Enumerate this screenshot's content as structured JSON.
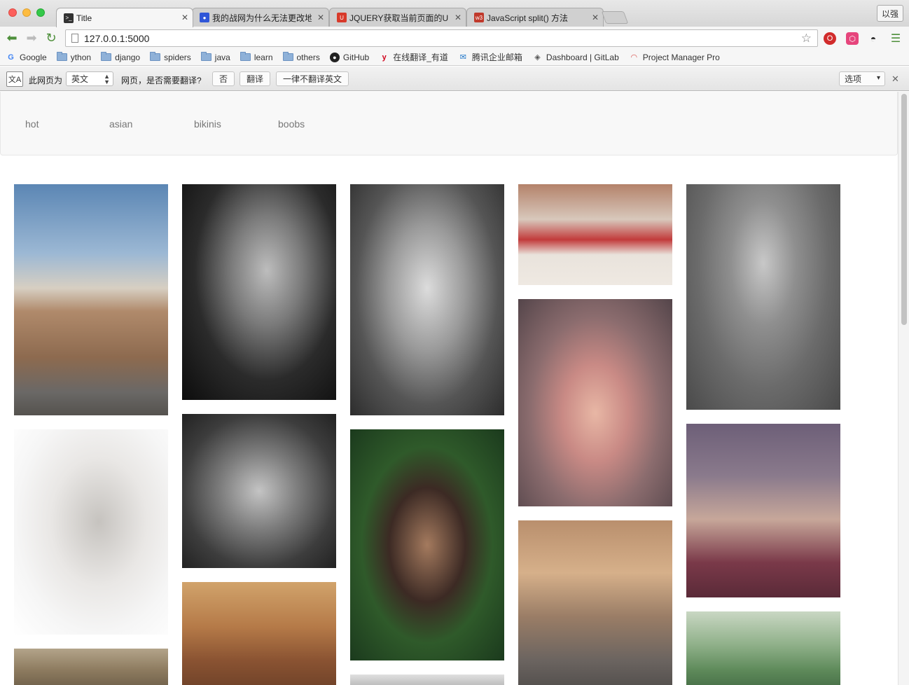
{
  "window": {
    "profile_button": "以强"
  },
  "tabs": [
    {
      "title": "Title",
      "favicon": "terminal-icon",
      "fav_color": "#333333",
      "active": true
    },
    {
      "title": "我的战网为什么无法更改地区",
      "favicon": "baidu-paw-icon",
      "fav_color": "#2f56d8",
      "active": false
    },
    {
      "title": "JQUERY获取当前页面的URL",
      "favicon": "u-logo-icon",
      "fav_color": "#d83a2a",
      "active": false
    },
    {
      "title": "JavaScript split() 方法",
      "favicon": "w3-icon",
      "fav_color": "#c0392b",
      "active": false
    }
  ],
  "toolbar": {
    "url": "127.0.0.1:5000"
  },
  "bookmarks": [
    {
      "label": "Google",
      "icon": "google-icon",
      "type": "site"
    },
    {
      "label": "ython",
      "icon": "folder-icon",
      "type": "folder"
    },
    {
      "label": "django",
      "icon": "folder-icon",
      "type": "folder"
    },
    {
      "label": "spiders",
      "icon": "folder-icon",
      "type": "folder"
    },
    {
      "label": "java",
      "icon": "folder-icon",
      "type": "folder"
    },
    {
      "label": "learn",
      "icon": "folder-icon",
      "type": "folder"
    },
    {
      "label": "others",
      "icon": "folder-icon",
      "type": "folder"
    },
    {
      "label": "GitHub",
      "icon": "github-icon",
      "type": "site"
    },
    {
      "label": "在线翻译_有道",
      "icon": "youdao-icon",
      "type": "site"
    },
    {
      "label": "腾讯企业邮箱",
      "icon": "mail-icon",
      "type": "site"
    },
    {
      "label": "Dashboard | GitLab",
      "icon": "gitlab-icon",
      "type": "site"
    },
    {
      "label": "Project Manager Pro",
      "icon": "rainbow-icon",
      "type": "site"
    }
  ],
  "translate_bar": {
    "prefix": "此网页为",
    "language": "英文",
    "question": "网页，是否需要翻译?",
    "no_button": "否",
    "translate_button": "翻译",
    "never_button": "一律不翻译英文",
    "options": "选项"
  },
  "page": {
    "nav_links": [
      "hot",
      "asian",
      "bikinis",
      "boobs"
    ]
  },
  "colors": {
    "accent_green": "#4d8f3a",
    "nav_text": "#777777"
  }
}
